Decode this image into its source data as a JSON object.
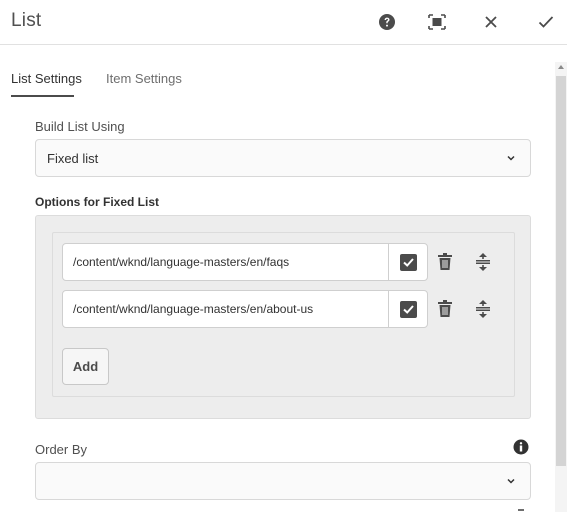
{
  "dialog": {
    "title": "List"
  },
  "header_actions": {
    "help_icon": "help-icon",
    "fullscreen_icon": "fullscreen-icon",
    "close_icon": "close-icon",
    "done_icon": "checkmark-icon"
  },
  "tabs": [
    {
      "label": "List Settings",
      "active": true
    },
    {
      "label": "Item Settings",
      "active": false
    }
  ],
  "build_list": {
    "label": "Build List Using",
    "value": "Fixed list"
  },
  "fixed_list": {
    "label": "Options for Fixed List",
    "items": [
      {
        "path": "/content/wknd/language-masters/en/faqs",
        "checked": true
      },
      {
        "path": "/content/wknd/language-masters/en/about-us",
        "checked": true
      }
    ],
    "add_label": "Add"
  },
  "order_by": {
    "label": "Order By",
    "value": ""
  },
  "colors": {
    "accent": "#4b4b4b",
    "background": "#ffffff",
    "multifield_bg": "#ededed"
  }
}
